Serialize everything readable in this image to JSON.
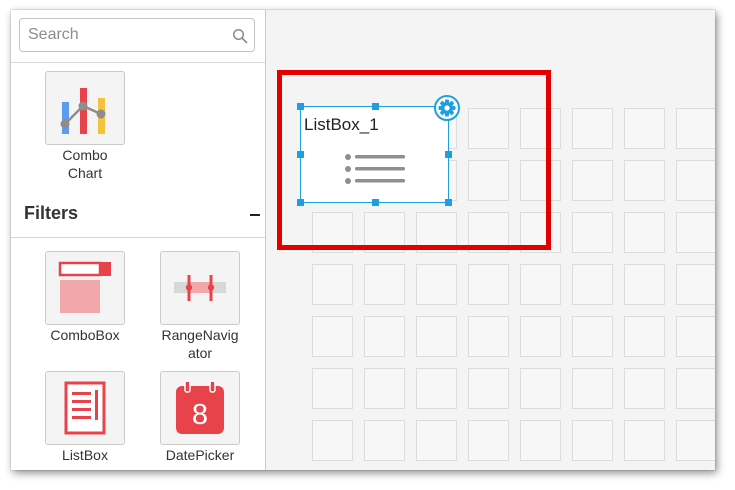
{
  "search": {
    "placeholder": "Search"
  },
  "chart_widgets": [
    {
      "label_line1": "Combo",
      "label_line2": "Chart"
    }
  ],
  "filters_section": {
    "title": "Filters",
    "collapse_icon": "minus-icon",
    "items": [
      {
        "label": "ComboBox",
        "icon": "combobox-icon"
      },
      {
        "label": "RangeNavigator",
        "icon": "range-navigator-icon"
      },
      {
        "label": "ListBox",
        "icon": "listbox-icon"
      },
      {
        "label": "DatePicker",
        "icon": "datepicker-icon",
        "icon_text": "8"
      }
    ]
  },
  "canvas": {
    "widget": {
      "title": "ListBox_1",
      "icon": "list-icon",
      "settings_icon": "gear-icon"
    }
  },
  "colors": {
    "accent": "#1e9fe0",
    "highlight": "#e50000",
    "filter_icon_red": "#e8434a",
    "filter_icon_pink": "#f2a8ab"
  }
}
